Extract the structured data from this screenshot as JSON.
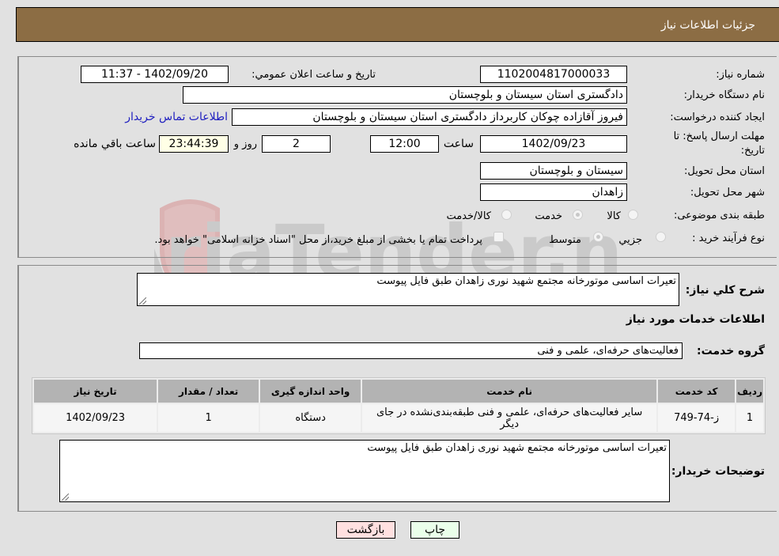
{
  "header": {
    "title": "جزئیات اطلاعات نیاز"
  },
  "details": {
    "need_number_label": "شماره نیاز:",
    "need_number": "1102004817000033",
    "announce_label": "تاریخ و ساعت اعلان عمومي:",
    "announce_value": "1402/09/20 - 11:37",
    "buyer_org_label": "نام دستگاه خریدار:",
    "buyer_org": "دادگستری استان سیستان و بلوچستان",
    "creator_label": "ایجاد کننده درخواست:",
    "creator": "فیروز آقازاده چوکان کاربرداز دادگستری استان سیستان و بلوچستان",
    "contact_link": "اطلاعات تماس خریدار",
    "deadline_label_1": "مهلت ارسال پاسخ: تا",
    "deadline_label_2": "تاریخ:",
    "deadline_date": "1402/09/23",
    "time_label": "ساعت",
    "deadline_time": "12:00",
    "days_value": "2",
    "days_label": "روز و",
    "remaining_time": "23:44:39",
    "remaining_label": "ساعت باقي مانده",
    "province_label": "استان محل تحویل:",
    "province": "سیستان و بلوچستان",
    "city_label": "شهر محل تحویل:",
    "city": "زاهدان",
    "category_label": "طبقه بندی موضوعی:",
    "category_options": [
      {
        "label": "کالا",
        "selected": false
      },
      {
        "label": "خدمت",
        "selected": true
      },
      {
        "label": "کالا/خدمت",
        "selected": false
      }
    ],
    "process_label": "نوع فرآیند خرید :",
    "process_options": [
      {
        "label": "جزيي",
        "selected": false
      },
      {
        "label": "متوسط",
        "selected": true
      }
    ],
    "treasury_checkbox_label": "پرداخت تمام یا بخشی از مبلغ خرید،از محل \"اسناد خزانه اسلامی\" خواهد بود.",
    "treasury_checked": false
  },
  "description": {
    "label": "شرح کلي نیاز:",
    "value": "تعیرات اساسی موتورخانه مجتمع شهید نوری زاهدان طبق فایل پیوست"
  },
  "services": {
    "section_title": "اطلاعات خدمات مورد نیاز",
    "group_label": "گروه خدمت:",
    "group_value": "فعالیت‌های حرفه‌ای، علمی و فنی",
    "columns": [
      "ردیف",
      "کد خدمت",
      "نام خدمت",
      "واحد اندازه گیری",
      "تعداد / مقدار",
      "تاریخ نیاز"
    ],
    "rows": [
      {
        "index": "1",
        "code": "ز-74-749",
        "name": "سایر فعالیت‌های حرفه‌ای، علمی و فنی طبقه‌بندی‌نشده در جای دیگر",
        "unit": "دستگاه",
        "quantity": "1",
        "date": "1402/09/23"
      }
    ]
  },
  "buyer_notes": {
    "label": "توضیحات خریدار:",
    "value": "تعیرات اساسی موتورخانه مجتمع شهید نوری زاهدان طبق فایل پیوست"
  },
  "actions": {
    "print_label": "چاپ",
    "back_label": "بازگشت",
    "print_color": "#eaffea",
    "back_color": "#ffe0e0"
  },
  "watermark": {
    "text": "AriaTender.neT"
  }
}
